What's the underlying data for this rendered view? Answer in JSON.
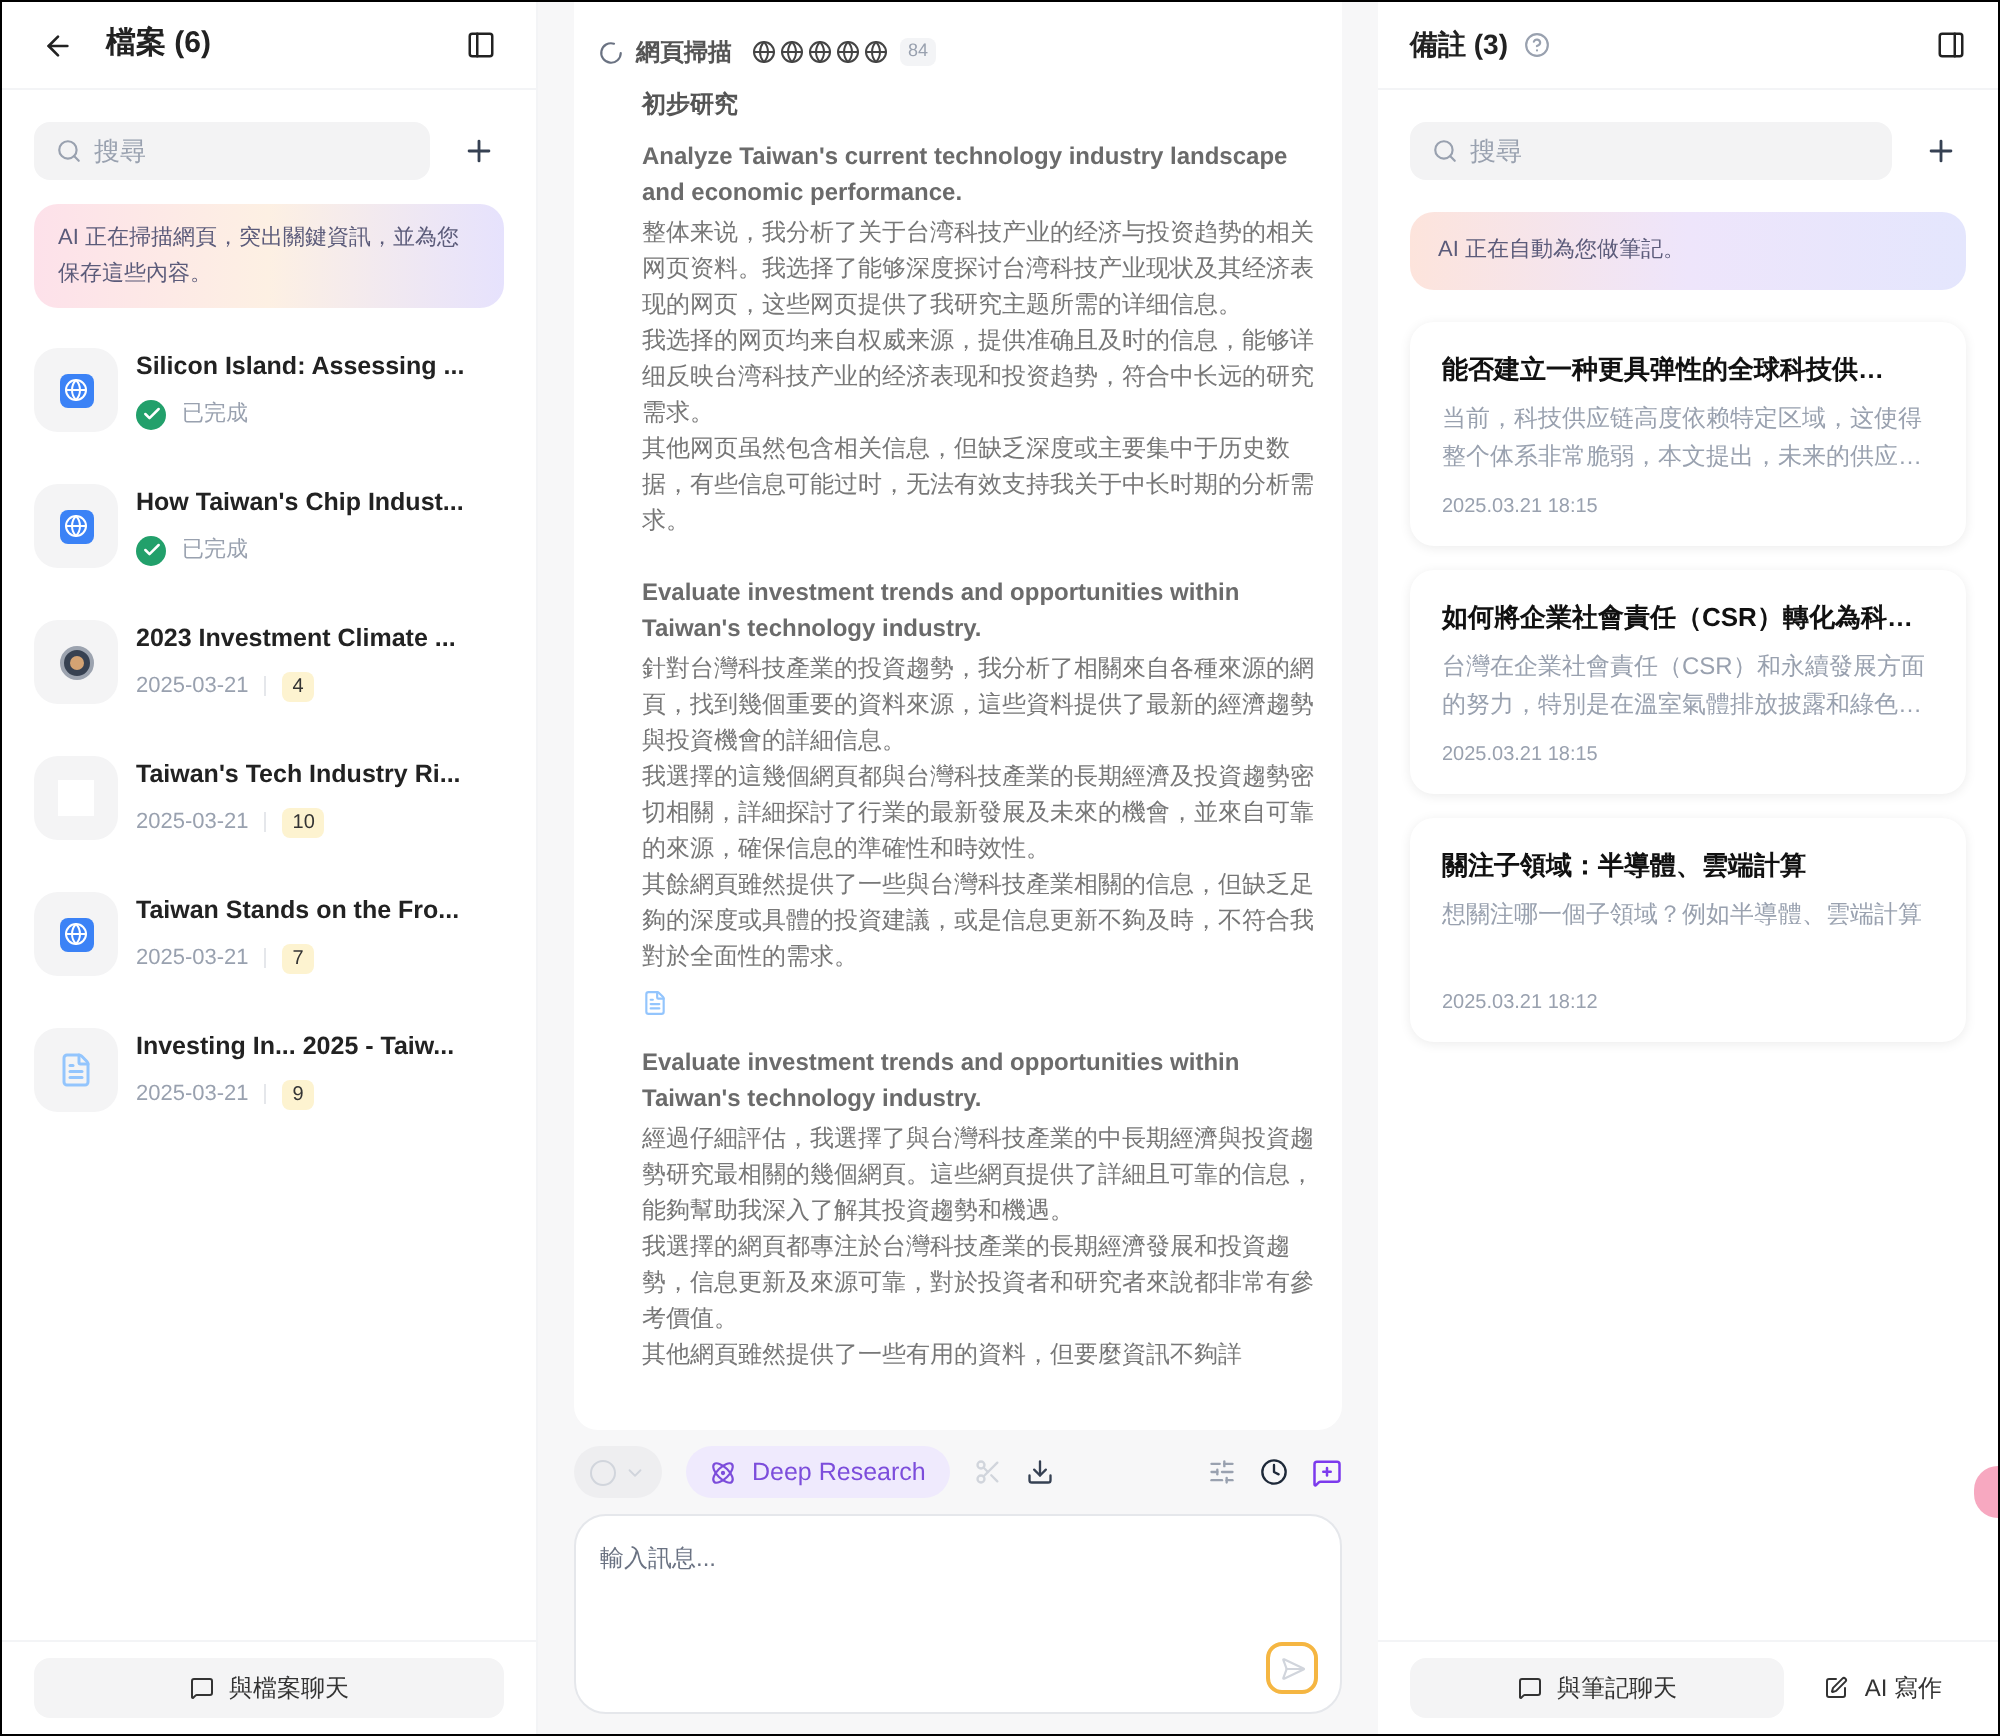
{
  "files_panel": {
    "title": "檔案 (6)",
    "search": {
      "placeholder": "搜尋"
    },
    "notice": "AI 正在掃描網頁，突出關鍵資訊，並為您保存這些內容。",
    "items": [
      {
        "kind": "globe",
        "title": "Silicon Island: Assessing ...",
        "status": "已完成"
      },
      {
        "kind": "globe",
        "title": "How Taiwan's Chip Indust...",
        "status": "已完成"
      },
      {
        "kind": "seal",
        "title": "2023 Investment Climate ...",
        "date": "2025-03-21",
        "count": "4"
      },
      {
        "kind": "blank",
        "title": "Taiwan's Tech Industry Ri...",
        "date": "2025-03-21",
        "count": "10"
      },
      {
        "kind": "globe",
        "title": "Taiwan Stands on the Fro...",
        "date": "2025-03-21",
        "count": "7"
      },
      {
        "kind": "document",
        "title": "Investing In... 2025 - Taiw...",
        "date": "2025-03-21",
        "count": "9"
      }
    ],
    "chat_button": "與檔案聊天"
  },
  "research": {
    "scan": {
      "label": "網頁掃描",
      "count": "84"
    },
    "heading": "初步研究",
    "sections": [
      {
        "kind": "step",
        "title": "Analyze Taiwan's current technology industry landscape and economic performance.",
        "paragraphs": [
          "整体来说，我分析了关于台湾科技产业的经济与投资趋势的相关网页资料。我选择了能够深度探讨台湾科技产业现状及其经济表现的网页，这些网页提供了我研究主题所需的详细信息。",
          "我选择的网页均来自权威来源，提供准确且及时的信息，能够详细反映台湾科技产业的经济表现和投资趋势，符合中长远的研究需求。",
          "其他网页虽然包含相关信息，但缺乏深度或主要集中于历史数据，有些信息可能过时，无法有效支持我关于中长时期的分析需求。"
        ]
      },
      {
        "kind": "step",
        "title": "Evaluate investment trends and opportunities within Taiwan's technology industry.",
        "paragraphs": [
          "針對台灣科技產業的投資趨勢，我分析了相關來自各種來源的網頁，找到幾個重要的資料來源，這些資料提供了最新的經濟趨勢與投資機會的詳細信息。",
          "我選擇的這幾個網頁都與台灣科技產業的長期經濟及投資趨勢密切相關，詳細探討了行業的最新發展及未來的機會，並來自可靠的來源，確保信息的準確性和時效性。",
          "其餘網頁雖然提供了一些與台灣科技產業相關的信息，但缺乏足夠的深度或具體的投資建議，或是信息更新不夠及時，不符合我對於全面性的需求。"
        ]
      },
      {
        "kind": "attachment"
      },
      {
        "kind": "step",
        "title": "Evaluate investment trends and opportunities within Taiwan's technology industry.",
        "paragraphs": [
          "經過仔細評估，我選擇了與台灣科技產業的中長期經濟與投資趨勢研究最相關的幾個網頁。這些網頁提供了詳細且可靠的信息，能夠幫助我深入了解其投資趨勢和機遇。",
          "我選擇的網頁都專注於台灣科技產業的長期經濟發展和投資趨勢，信息更新及來源可靠，對於投資者和研究者來說都非常有參考價值。",
          "其他網頁雖然提供了一些有用的資料，但要麼資訊不夠詳"
        ]
      }
    ],
    "toolbar": {
      "deep_research": {
        "label": "Deep Research",
        "selected": true
      }
    },
    "input": {
      "placeholder": "輸入訊息..."
    }
  },
  "notes_panel": {
    "title": "備註 (3)",
    "search": {
      "placeholder": "搜尋"
    },
    "notice": "AI 正在自動為您做筆記。",
    "notes": [
      {
        "title": "能否建立一种更具弹性的全球科技供…",
        "body": "当前，科技供应链高度依赖特定区域，这使得整个体系非常脆弱，本文提出，未来的供应…",
        "time": "2025.03.21 18:15"
      },
      {
        "title": "如何將企業社會責任（CSR）轉化為科…",
        "body": "台灣在企業社會責任（CSR）和永續發展方面的努力，特別是在溫室氣體排放披露和綠色…",
        "time": "2025.03.21 18:15"
      },
      {
        "title": "關注子領域：半導體、雲端計算",
        "body": "想關注哪一個子領域？例如半導體、雲端計算",
        "time": "2025.03.21 18:12"
      }
    ],
    "buttons": [
      {
        "kind": "chat",
        "label": "與筆記聊天"
      },
      {
        "kind": "write",
        "label": "AI 寫作"
      }
    ]
  }
}
